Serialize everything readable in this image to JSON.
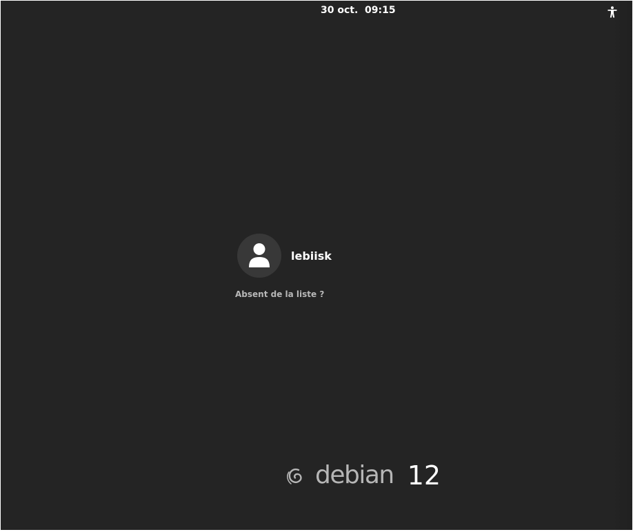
{
  "top_bar": {
    "clock": "30 oct.  09:15",
    "accessibility_icon": "accessibility-icon"
  },
  "login": {
    "users": [
      {
        "name": "lebiisk",
        "avatar_icon": "user-avatar-icon"
      }
    ],
    "not_listed_label": "Absent de la liste ?"
  },
  "branding": {
    "swirl_icon": "debian-swirl-icon",
    "wordmark": "debian",
    "version": "12"
  },
  "colors": {
    "background": "#242424",
    "avatar_bg": "#383838",
    "text": "#ffffff",
    "muted_text": "#b8b8b8"
  }
}
